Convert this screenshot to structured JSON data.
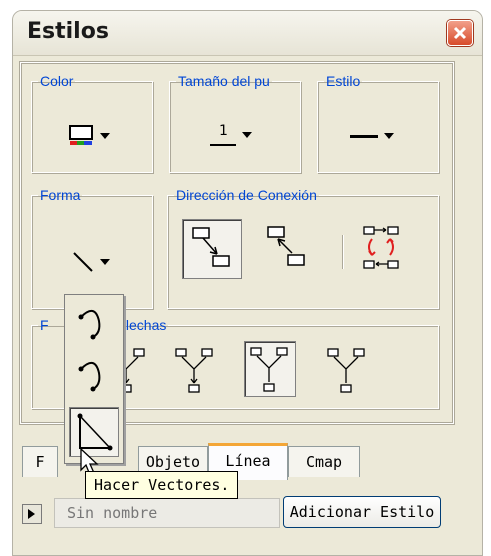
{
  "window": {
    "title": "Estilos"
  },
  "groups": {
    "color": "Color",
    "point_size": "Tamaño del pu",
    "style": "Estilo",
    "shape": "Forma",
    "connection_direction": "Dirección de Conexión",
    "arrowheads": "e las flechas",
    "arrowheads_prefix": "F"
  },
  "point_size_value": "1",
  "tabs": [
    "F",
    "Objeto",
    "Línea",
    "Cmap"
  ],
  "active_tab": "Línea",
  "name_field_value": "Sin nombre",
  "add_style_button": "Adicionar Estilo",
  "tooltip": "Hacer Vectores.",
  "popup_items": [
    "curve-icon",
    "curve-arrow-icon",
    "vectors-icon"
  ],
  "colors": {
    "accent_tab": "#f4a636",
    "legend_text": "#0046d5",
    "close_red": "#d74b2b",
    "arrow_red": "#e02020"
  }
}
